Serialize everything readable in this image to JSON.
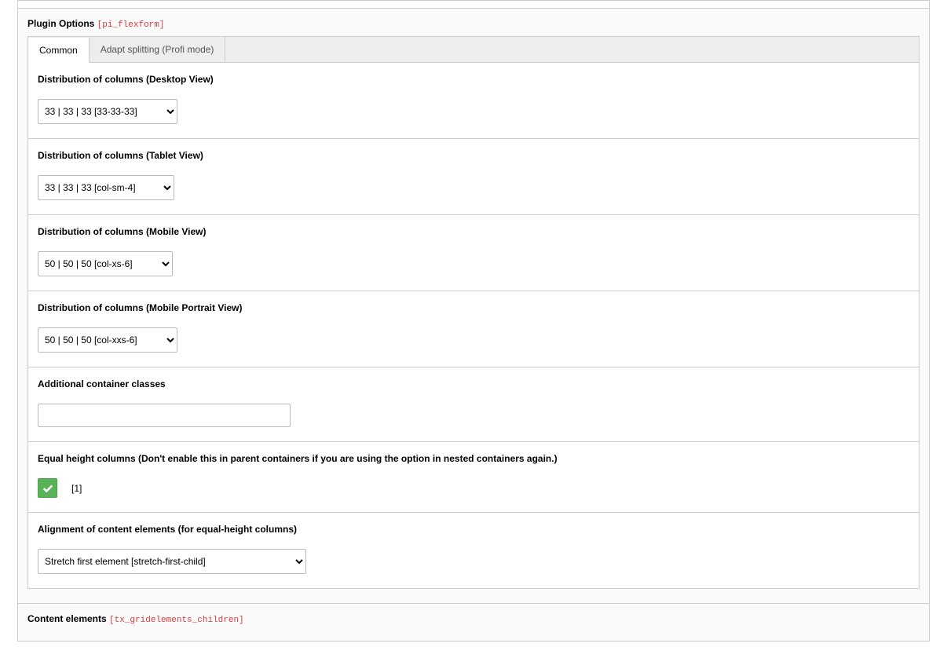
{
  "plugin_options": {
    "title": "Plugin Options",
    "tech": "[pi_flexform]",
    "tabs": [
      {
        "label": "Common"
      },
      {
        "label": "Adapt splitting (Profi mode)"
      }
    ],
    "fields": {
      "desktop": {
        "label": "Distribution of columns (Desktop View)",
        "value": "33 | 33 | 33 [33-33-33]"
      },
      "tablet": {
        "label": "Distribution of columns (Tablet View)",
        "value": "33 | 33 | 33 [col-sm-4]"
      },
      "mobile": {
        "label": "Distribution of columns (Mobile View)",
        "value": "50 | 50 | 50 [col-xs-6]"
      },
      "mobile_portrait": {
        "label": "Distribution of columns (Mobile Portrait View)",
        "value": "50 | 50 | 50 [col-xxs-6]"
      },
      "additional_classes": {
        "label": "Additional container classes",
        "value": ""
      },
      "equal_height": {
        "label": "Equal height columns (Don't enable this in parent containers if you are using the option in nested containers again.)",
        "checked": true,
        "value_text": "[1]"
      },
      "alignment": {
        "label": "Alignment of content elements (for equal-height columns)",
        "value": "Stretch first element [stretch-first-child]"
      }
    }
  },
  "content_elements": {
    "title": "Content elements",
    "tech": "[tx_gridelements_children]"
  }
}
